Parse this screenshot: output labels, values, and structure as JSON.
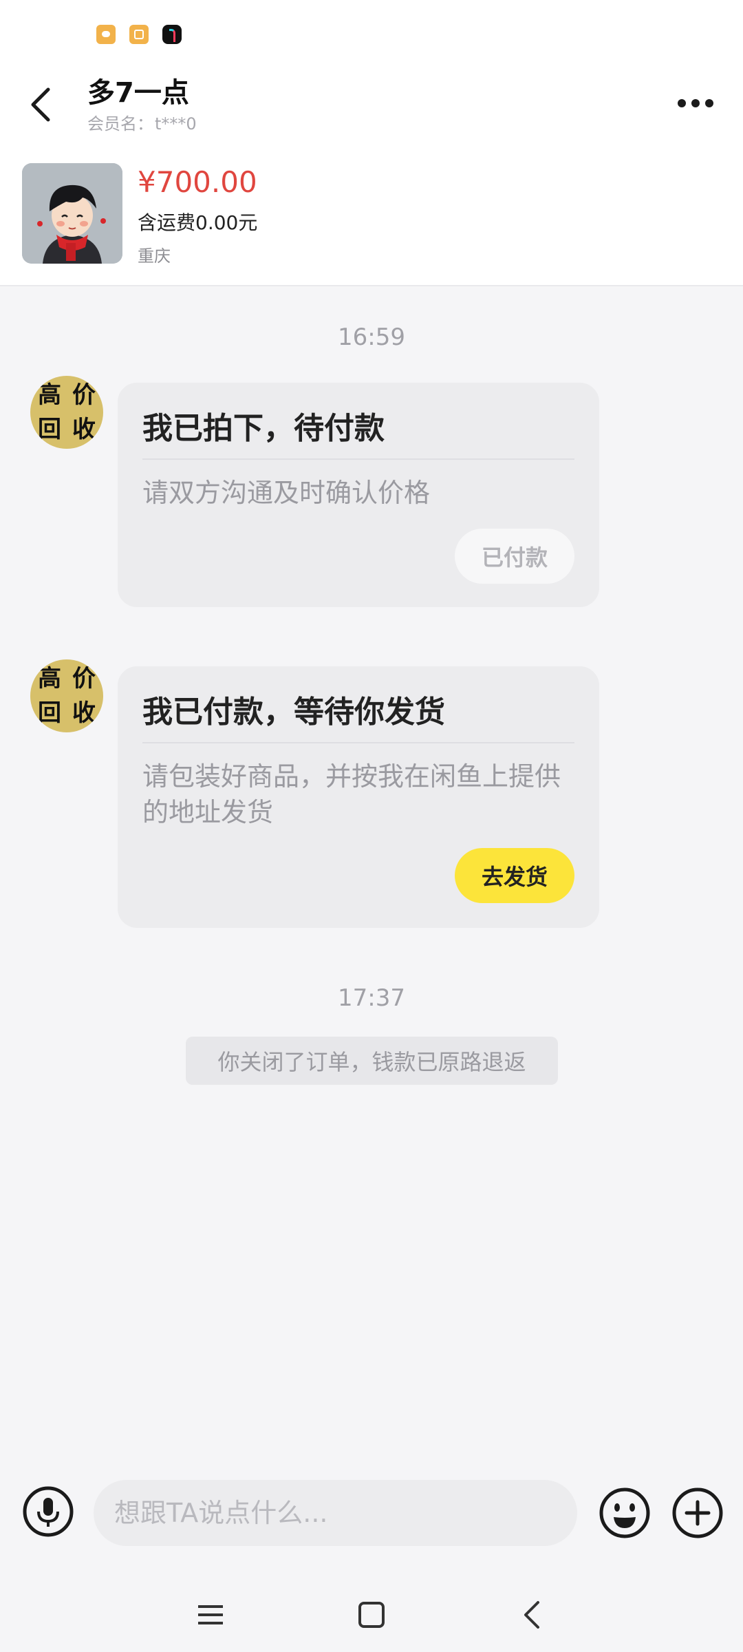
{
  "header": {
    "title": "多7一点",
    "member_label": "会员名：",
    "member_value": "t***0"
  },
  "product": {
    "price": "¥700.00",
    "shipping": "含运费0.00元",
    "location": "重庆"
  },
  "messages": [
    {
      "time": "16:59",
      "avatar_text": [
        "高",
        "价",
        "回",
        "收"
      ],
      "title": "我已拍下，待付款",
      "desc": "请双方沟通及时确认价格",
      "button": "已付款"
    },
    {
      "avatar_text": [
        "高",
        "价",
        "回",
        "收"
      ],
      "title": "我已付款，等待你发货",
      "desc": "请包装好商品，并按我在闲鱼上提供的地址发货",
      "button": "去发货"
    }
  ],
  "second_time": "17:37",
  "system_notice": "你关闭了订单，钱款已原路退返",
  "input": {
    "placeholder": "想跟TA说点什么..."
  },
  "colors": {
    "price": "#e0463f",
    "accent_button": "#fce43a",
    "background": "#f5f5f7"
  },
  "icons": [
    "back-arrow-icon",
    "more-icon",
    "mic-icon",
    "emoji-icon",
    "plus-icon",
    "menu-icon",
    "home-icon",
    "nav-back-icon"
  ]
}
